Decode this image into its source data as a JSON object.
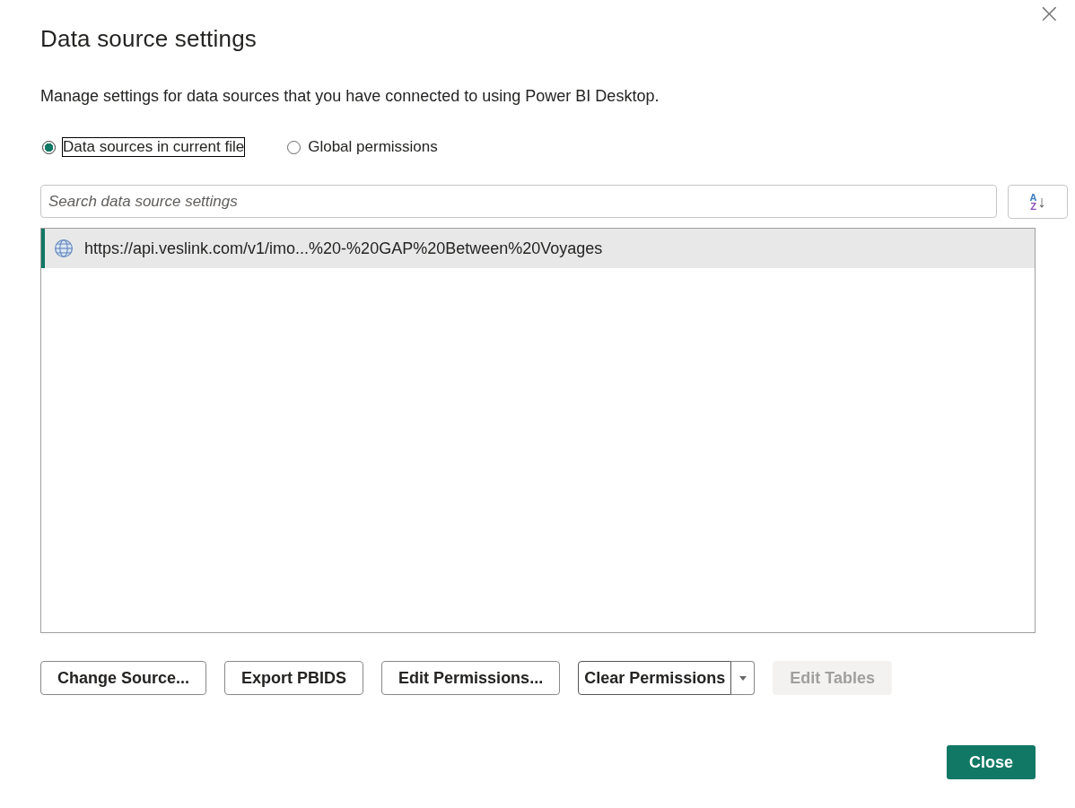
{
  "window": {
    "title": "Data source settings",
    "close": "×"
  },
  "description": "Manage settings for data sources that you have connected to using Power BI Desktop.",
  "scope_options": [
    {
      "label": "Data sources in current file",
      "selected": true,
      "focused": true
    },
    {
      "label": "Global permissions",
      "selected": false,
      "focused": false
    }
  ],
  "search": {
    "placeholder": "Search data source settings"
  },
  "sort_button": {
    "top": "A",
    "bottom": "Z",
    "arrow": "↓"
  },
  "sources": [
    {
      "label": "https://api.veslink.com/v1/imo...%20-%20GAP%20Between%20Voyages",
      "selected": true
    }
  ],
  "buttons": [
    {
      "kind": "button",
      "label": "Change Source...",
      "disabled": false,
      "focused": false
    },
    {
      "kind": "button",
      "label": "Export PBIDS",
      "disabled": false,
      "focused": false
    },
    {
      "kind": "button",
      "label": "Edit Permissions...",
      "disabled": false,
      "focused": false
    },
    {
      "kind": "split",
      "label": "Clear Permissions",
      "disabled": false,
      "focused": true
    },
    {
      "kind": "button",
      "label": "Edit Tables",
      "disabled": true,
      "focused": false
    }
  ],
  "footer_button": {
    "label": "Close"
  }
}
